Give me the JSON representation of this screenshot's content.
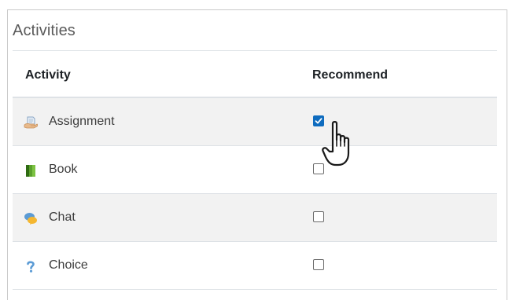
{
  "panel": {
    "title": "Activities"
  },
  "table": {
    "headers": {
      "activity": "Activity",
      "recommend": "Recommend"
    },
    "rows": [
      {
        "label": "Assignment",
        "icon": "assignment-icon",
        "checked": true
      },
      {
        "label": "Book",
        "icon": "book-icon",
        "checked": false
      },
      {
        "label": "Chat",
        "icon": "chat-icon",
        "checked": false
      },
      {
        "label": "Choice",
        "icon": "choice-icon",
        "checked": false
      }
    ]
  },
  "colors": {
    "checkbox_checked": "#0f6cbf",
    "row_stripe": "#f2f2f2"
  }
}
